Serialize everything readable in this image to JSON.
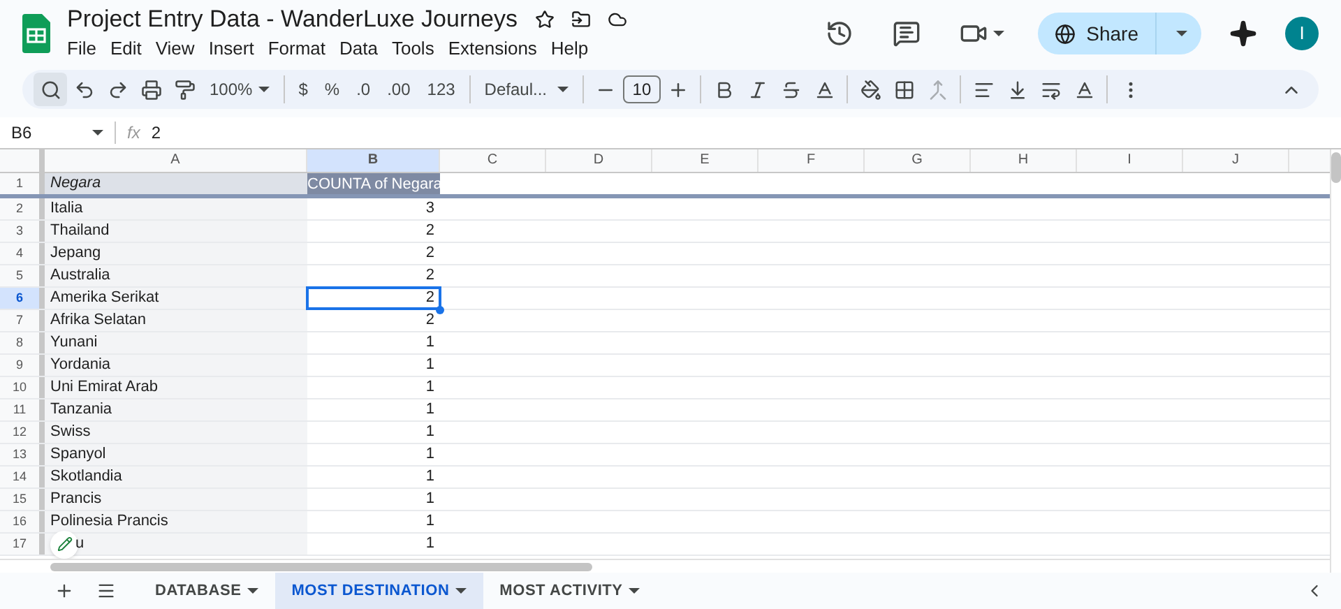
{
  "title": "Project Entry Data - WanderLuxe Journeys",
  "menu": [
    "File",
    "Edit",
    "View",
    "Insert",
    "Format",
    "Data",
    "Tools",
    "Extensions",
    "Help"
  ],
  "share": "Share",
  "avatar": "I",
  "toolbar": {
    "zoom": "100%",
    "currency": "$",
    "percent": "%",
    "dec_less": ".0",
    "dec_more": ".00",
    "number_format": "123",
    "font": "Defaul...",
    "font_size": "10"
  },
  "name_box": "B6",
  "fx": "fx",
  "formula": "2",
  "columns": [
    {
      "label": "A",
      "selected": false
    },
    {
      "label": "B",
      "selected": true
    },
    {
      "label": "C",
      "selected": false
    },
    {
      "label": "D",
      "selected": false
    },
    {
      "label": "E",
      "selected": false
    },
    {
      "label": "F",
      "selected": false
    },
    {
      "label": "G",
      "selected": false
    },
    {
      "label": "H",
      "selected": false
    },
    {
      "label": "I",
      "selected": false
    },
    {
      "label": "J",
      "selected": false
    }
  ],
  "rows": [
    {
      "num": "1",
      "a": "Negara",
      "b": "COUNTA of Negara",
      "kind": "header",
      "selected": false
    },
    {
      "num": "2",
      "a": "Italia",
      "b": "3",
      "kind": "data",
      "selected": false
    },
    {
      "num": "3",
      "a": "Thailand",
      "b": "2",
      "kind": "data",
      "selected": false
    },
    {
      "num": "4",
      "a": "Jepang",
      "b": "2",
      "kind": "data",
      "selected": false
    },
    {
      "num": "5",
      "a": "Australia",
      "b": "2",
      "kind": "data",
      "selected": false
    },
    {
      "num": "6",
      "a": "Amerika Serikat",
      "b": "2",
      "kind": "data",
      "selected": true
    },
    {
      "num": "7",
      "a": "Afrika Selatan",
      "b": "2",
      "kind": "data",
      "selected": false
    },
    {
      "num": "8",
      "a": "Yunani",
      "b": "1",
      "kind": "data",
      "selected": false
    },
    {
      "num": "9",
      "a": "Yordania",
      "b": "1",
      "kind": "data",
      "selected": false
    },
    {
      "num": "10",
      "a": "Uni Emirat Arab",
      "b": "1",
      "kind": "data",
      "selected": false
    },
    {
      "num": "11",
      "a": "Tanzania",
      "b": "1",
      "kind": "data",
      "selected": false
    },
    {
      "num": "12",
      "a": "Swiss",
      "b": "1",
      "kind": "data",
      "selected": false
    },
    {
      "num": "13",
      "a": "Spanyol",
      "b": "1",
      "kind": "data",
      "selected": false
    },
    {
      "num": "14",
      "a": "Skotlandia",
      "b": "1",
      "kind": "data",
      "selected": false
    },
    {
      "num": "15",
      "a": "Prancis",
      "b": "1",
      "kind": "data",
      "selected": false
    },
    {
      "num": "16",
      "a": "Polinesia Prancis",
      "b": "1",
      "kind": "data",
      "selected": false
    },
    {
      "num": "17",
      "a": "u",
      "b": "1",
      "kind": "covered",
      "selected": false
    }
  ],
  "sheets": [
    {
      "label": "DATABASE",
      "selected": false
    },
    {
      "label": "MOST DESTINATION",
      "selected": true
    },
    {
      "label": "MOST ACTIVITY",
      "selected": false
    }
  ]
}
